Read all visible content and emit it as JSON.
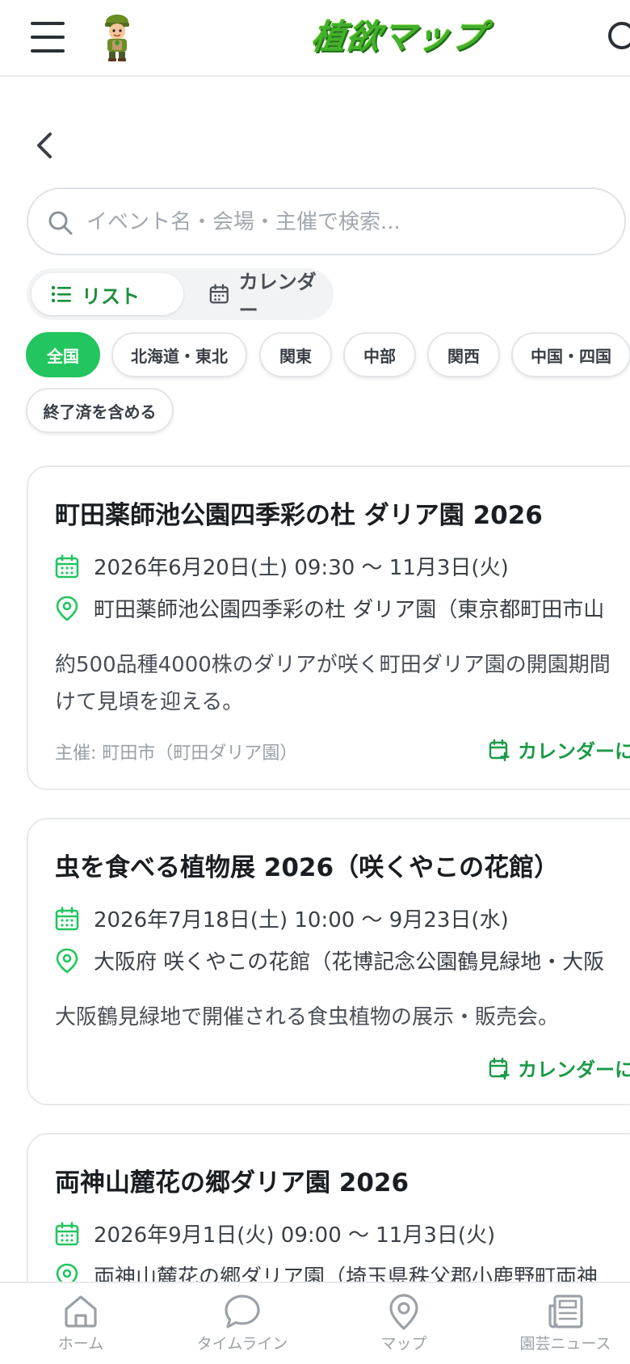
{
  "header": {
    "logo_text": "植欲マップ"
  },
  "search": {
    "placeholder": "イベント名・会場・主催で検索..."
  },
  "view_toggle": {
    "list_label": "リスト",
    "calendar_label": "カレンダー",
    "selected": "リスト"
  },
  "regions": {
    "chips": [
      "全国",
      "北海道・東北",
      "関東",
      "中部",
      "関西",
      "中国・四国"
    ],
    "selected": "全国",
    "include_ended_label": "終了済を含める"
  },
  "events": [
    {
      "title": "町田薬師池公園四季彩の杜 ダリア園 2026",
      "date": "2026年6月20日(土) 09:30 〜 11月3日(火)",
      "location": "町田薬師池公園四季彩の杜 ダリア園（東京都町田市山",
      "description": "約500品種4000株のダリアが咲く町田ダリア園の開園期間",
      "description2": "けて見頃を迎える。",
      "organizer": "主催: 町田市（町田ダリア園）",
      "calendar_action": "カレンダーに"
    },
    {
      "title": "虫を食べる植物展 2026（咲くやこの花館）",
      "date": "2026年7月18日(土) 10:00 〜 9月23日(水)",
      "location": "大阪府 咲くやこの花館（花博記念公園鶴見緑地・大阪",
      "description": "大阪鶴見緑地で開催される食虫植物の展示・販売会。",
      "calendar_action": "カレンダーに"
    },
    {
      "title": "両神山麓花の郷ダリア園 2026",
      "date": "2026年9月1日(火) 09:00 〜 11月3日(火)",
      "location": "両神山麓花の郷ダリア園（埼玉県秩父郡小鹿野町両神"
    }
  ],
  "bottom_nav": [
    {
      "label": "ホーム",
      "icon": "home-icon"
    },
    {
      "label": "タイムライン",
      "icon": "chat-bubble-icon"
    },
    {
      "label": "マップ",
      "icon": "map-pin-icon"
    },
    {
      "label": "園芸ニュース",
      "icon": "newspaper-icon"
    }
  ],
  "colors": {
    "accent_green": "#22c55e",
    "text_green": "#1b9a47",
    "logo_green": "#43b02a",
    "nav_gray": "#9ca1a8"
  }
}
